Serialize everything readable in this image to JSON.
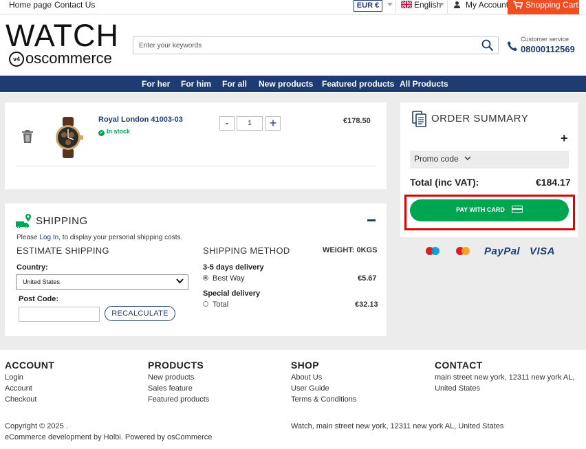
{
  "topbar": {
    "home": "Home page",
    "contact": "Contact Us",
    "currency": "EUR €",
    "language": "English",
    "account": "My Account",
    "cart": "Shopping Cart"
  },
  "header": {
    "logo_main": "WATCH",
    "logo_sub": "oscommerce",
    "logo_badge": "v4",
    "search_placeholder": "Enter your keywords",
    "customer_service_label": "Customer service",
    "customer_service_phone": "08000112569"
  },
  "nav": [
    "For her",
    "For him",
    "For all",
    "New products",
    "Featured products",
    "All Products"
  ],
  "cart": {
    "item_name": "Royal London 41003-03",
    "stock": "In stock",
    "quantity": "1",
    "minus": "-",
    "plus": "+",
    "price": "€178.50"
  },
  "summary": {
    "title": "ORDER SUMMARY",
    "toggle": "+",
    "promo": "Promo code",
    "total_label": "Total (inc VAT):",
    "total_value": "€184.17",
    "pay_button": "PAY WITH CARD",
    "payment_methods": [
      "maestro",
      "mastercard",
      "PayPal",
      "VISA"
    ],
    "paypal": "PayPal",
    "visa": "VISA"
  },
  "shipping": {
    "title": "SHIPPING",
    "note_prefix": "Please ",
    "note_link": "Log In",
    "note_suffix": ", to display your personal shipping costs.",
    "estimate_title": "ESTIMATE SHIPPING",
    "country_label": "Country:",
    "country_value": "United States",
    "postcode_label": "Post Code:",
    "postcode_value": "",
    "recalculate": "RECALCULATE",
    "method_title": "SHIPPING METHOD",
    "weight": "WEIGHT: 0KGS",
    "groups": [
      {
        "name": "3-5 days delivery",
        "option": "Best Way",
        "price": "€5.67",
        "selected": true
      },
      {
        "name": "Special delivery",
        "option": "Total",
        "price": "€32.13",
        "selected": false
      }
    ]
  },
  "footer": {
    "account": {
      "title": "ACCOUNT",
      "links": [
        "Login",
        "Account",
        "Checkout"
      ]
    },
    "products": {
      "title": "PRODUCTS",
      "links": [
        "New products",
        "Sales feature",
        "Featured products"
      ]
    },
    "shop": {
      "title": "SHOP",
      "links": [
        "About Us",
        "User Guide",
        "Terms & Conditions"
      ]
    },
    "contact": {
      "title": "CONTACT",
      "address_line1": "main street new york, 12311 new york AL,",
      "address_line2": "United States"
    },
    "copyright": "Copyright © 2025 .",
    "credit": "eCommerce development by Holbi. Powered by osCommerce",
    "address": "Watch, main street new york, 12311 new york AL, United States"
  },
  "colors": {
    "brand_blue": "#1e3c72",
    "cart_orange": "#f14e1f",
    "pay_green": "#00a551",
    "highlight_red": "#e00000"
  }
}
